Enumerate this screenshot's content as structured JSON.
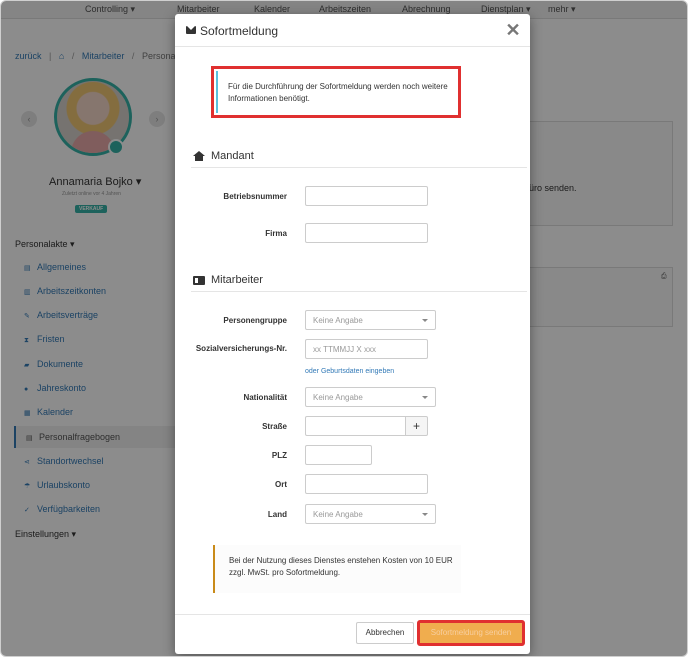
{
  "topnav": {
    "controlling": "Controlling ▾",
    "mitarbeiter": "Mitarbeiter",
    "kalender": "Kalender",
    "arbeitszeiten": "Arbeitszeiten",
    "abrechnung": "Abrechnung",
    "dienstplan": "Dienstplan ▾",
    "mehr": "mehr ▾"
  },
  "breadcrumb": {
    "back": "zurück",
    "mitarbeiter": "Mitarbeiter",
    "current": "Personal"
  },
  "profile": {
    "name": "Annamaria Bojko ▾",
    "status": "Zuletzt online vor 4 Jahren",
    "badge": "VERKAUF"
  },
  "sidebar": {
    "personalakte": "Personalakte ▾",
    "items": [
      {
        "label": "Allgemeines"
      },
      {
        "label": "Arbeitszeitkonten"
      },
      {
        "label": "Arbeitsverträge"
      },
      {
        "label": "Fristen"
      },
      {
        "label": "Dokumente"
      },
      {
        "label": "Jahreskonto"
      },
      {
        "label": "Kalender"
      },
      {
        "label": "Personalfragebogen"
      },
      {
        "label": "Standortwechsel"
      },
      {
        "label": "Urlaubskonto"
      },
      {
        "label": "Verfügbarkeiten"
      }
    ],
    "einstellungen": "Einstellungen ▾"
  },
  "background": {
    "text_fragment": "üro senden."
  },
  "modal": {
    "title": "Sofortmeldung",
    "info_message": "Für die Durchführung der Sofortmeldung werden noch weitere Informationen benötigt.",
    "section_mandant": "Mandant",
    "betriebsnummer_label": "Betriebsnummer",
    "firma_label": "Firma",
    "section_mitarbeiter": "Mitarbeiter",
    "personengruppe_label": "Personengruppe",
    "personengruppe_value": "Keine Angabe",
    "sv_label": "Sozialversicherungs-Nr.",
    "sv_placeholder": "xx TTMMJJ X xxx",
    "geburtsdaten_link": "oder Geburtsdaten eingeben",
    "nationalitaet_label": "Nationalität",
    "nationalitaet_value": "Keine Angabe",
    "strasse_label": "Straße",
    "add_symbol": "+",
    "plz_label": "PLZ",
    "ort_label": "Ort",
    "land_label": "Land",
    "land_value": "Keine Angabe",
    "cost_notice": "Bei der Nutzung dieses Dienstes enstehen Kosten von 10 EUR zzgl. MwSt. pro Sofortmeldung.",
    "cancel_label": "Abbrechen",
    "submit_label": "Sofortmeldung senden"
  }
}
